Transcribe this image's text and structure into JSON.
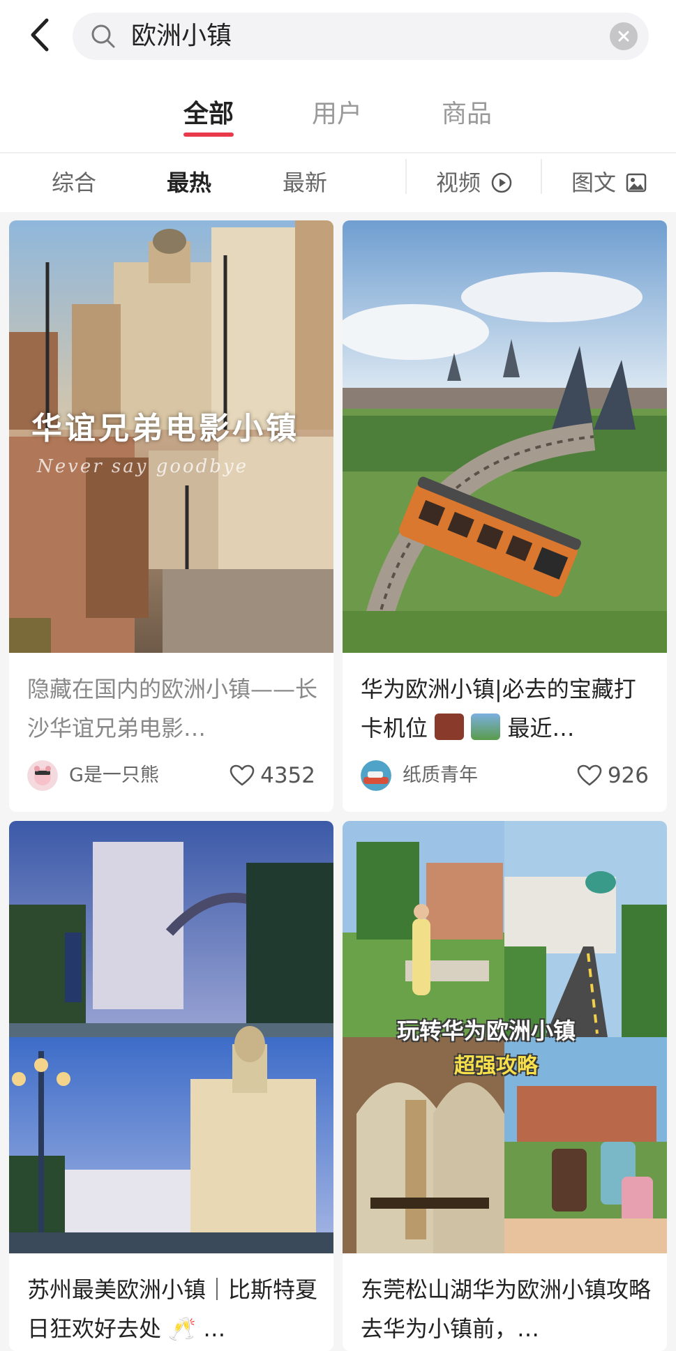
{
  "search": {
    "query": "欧洲小镇"
  },
  "main_tabs": [
    {
      "label": "全部",
      "active": true
    },
    {
      "label": "用户",
      "active": false
    },
    {
      "label": "商品",
      "active": false
    }
  ],
  "filters": [
    {
      "label": "综合",
      "active": false
    },
    {
      "label": "最热",
      "active": true
    },
    {
      "label": "最新",
      "active": false
    },
    {
      "label": "视频",
      "active": false
    },
    {
      "label": "图文",
      "active": false
    }
  ],
  "cards": [
    {
      "title": "隐藏在国内的欧洲小镇——长沙华谊兄弟电影…",
      "image_overlay": "华谊兄弟电影小镇",
      "image_overlay_sub": "Never say goodbye",
      "author": "G是一只熊",
      "likes": "4352"
    },
    {
      "title": "华为欧洲小镇|必去的宝藏打卡机位",
      "title_tail": "最近…",
      "author": "纸质青年",
      "likes": "926"
    },
    {
      "title": "苏州最美欧洲小镇｜比斯特夏日狂欢好去处",
      "title_tail": "…"
    },
    {
      "title": "东莞松山湖华为欧洲小镇攻略 去华为小镇前，…",
      "image_overlay": "玩转华为欧洲小镇",
      "image_overlay_sub": "超强攻略"
    }
  ],
  "colors": {
    "accent": "#e83a4b",
    "feed_background": "#f5f5f5"
  }
}
